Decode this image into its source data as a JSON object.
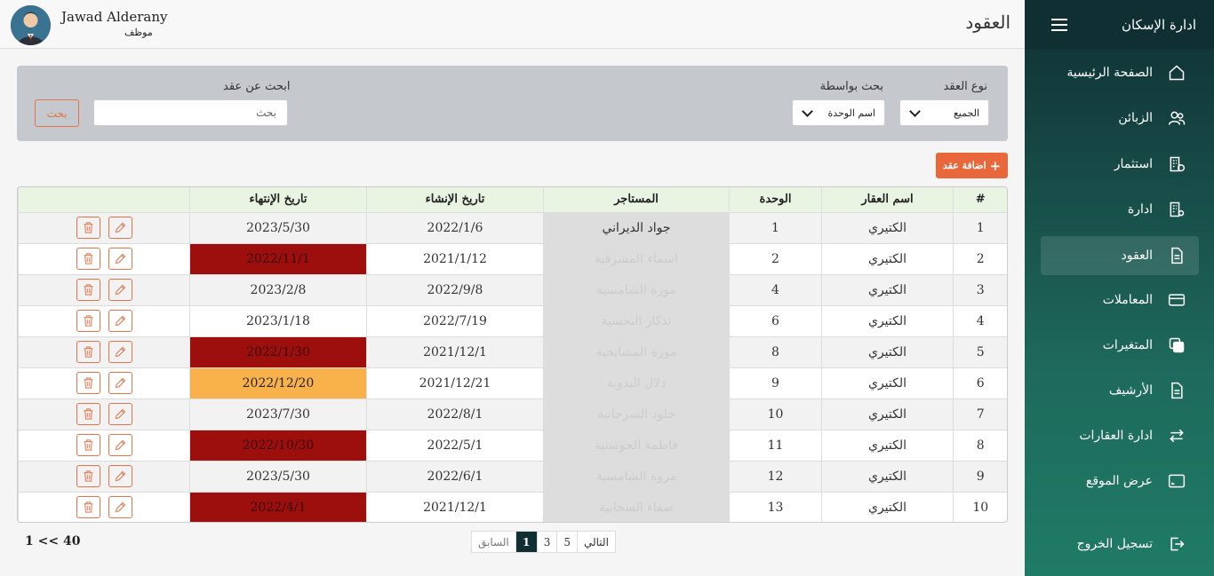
{
  "sidebar": {
    "brand": "ادارة الإسكان",
    "items": [
      {
        "label": "الصفحة الرئيسية",
        "icon": "home-icon"
      },
      {
        "label": "الزبائن",
        "icon": "users-icon"
      },
      {
        "label": "استثمار",
        "icon": "building-dollar-icon"
      },
      {
        "label": "ادارة",
        "icon": "building-gear-icon"
      },
      {
        "label": "العقود",
        "icon": "document-icon"
      },
      {
        "label": "المعاملات",
        "icon": "credit-card-icon"
      },
      {
        "label": "المتغيرات",
        "icon": "copy-icon"
      },
      {
        "label": "الأرشيف",
        "icon": "archive-document-icon"
      },
      {
        "label": "ادارة العقارات",
        "icon": "arrows-exchange-icon"
      },
      {
        "label": "عرض الموقع",
        "icon": "screen-icon"
      }
    ],
    "logout": "تسجيل الخروج"
  },
  "header": {
    "title": "العقود",
    "user_name": "Jawad Alderany",
    "user_role": "موظف"
  },
  "filters": {
    "type_label": "نوع العقد",
    "type_value": "الجميع",
    "by_label": "بحث بواسطة",
    "by_value": "اسم الوحدة",
    "search_label": "ابحث عن عقد",
    "search_placeholder": "بحث",
    "search_button": "بحث"
  },
  "add_button": "اضافة عقد",
  "table": {
    "headers": [
      "#",
      "اسم العقار",
      "الوحدة",
      "المستاجر",
      "تاريخ الإنشاء",
      "تاريخ الإنتهاء",
      ""
    ],
    "rows": [
      {
        "num": "1",
        "property": "الكتيري",
        "unit": "1",
        "tenant": "جواد الديراني",
        "created": "2022/1/6",
        "end": "2023/5/30",
        "status": "normal"
      },
      {
        "num": "2",
        "property": "الكتيري",
        "unit": "2",
        "tenant": "اسماء المشرفية",
        "created": "2021/1/12",
        "end": "2022/11/1",
        "status": "overdue"
      },
      {
        "num": "3",
        "property": "الكتيري",
        "unit": "4",
        "tenant": "موزة الشامسية",
        "created": "2022/9/8",
        "end": "2023/2/8",
        "status": "normal"
      },
      {
        "num": "4",
        "property": "الكتيري",
        "unit": "6",
        "tenant": "تذكار التحسية",
        "created": "2022/7/19",
        "end": "2023/1/18",
        "status": "normal"
      },
      {
        "num": "5",
        "property": "الكتيري",
        "unit": "8",
        "tenant": "موزة المشايخية",
        "created": "2021/12/1",
        "end": "2022/1/30",
        "status": "overdue"
      },
      {
        "num": "6",
        "property": "الكتيري",
        "unit": "9",
        "tenant": "دلال البدوية",
        "created": "2021/12/21",
        "end": "2022/12/20",
        "status": "soon"
      },
      {
        "num": "7",
        "property": "الكتيري",
        "unit": "10",
        "tenant": "خلود السرحانية",
        "created": "2022/8/1",
        "end": "2023/7/30",
        "status": "normal"
      },
      {
        "num": "8",
        "property": "الكتيري",
        "unit": "11",
        "tenant": "فاطمة الحوسنية",
        "created": "2022/5/1",
        "end": "2022/10/30",
        "status": "overdue"
      },
      {
        "num": "9",
        "property": "الكتيري",
        "unit": "12",
        "tenant": "مروة الشامسية",
        "created": "2022/6/1",
        "end": "2023/5/30",
        "status": "normal"
      },
      {
        "num": "10",
        "property": "الكتيري",
        "unit": "13",
        "tenant": "صفاء السحابية",
        "created": "2021/12/1",
        "end": "2022/4/1",
        "status": "overdue"
      }
    ]
  },
  "pagination": {
    "prev": "السابق",
    "pages": [
      "1",
      "3",
      "5"
    ],
    "current": "1",
    "next": "التالي",
    "summary": "1 << 40"
  },
  "colors": {
    "sidebar_dark": "#0f2f33",
    "accent": "#e8683c",
    "overdue": "#9c0f0d",
    "soon": "#f9b24b",
    "header_row": "#e9f4e2"
  }
}
